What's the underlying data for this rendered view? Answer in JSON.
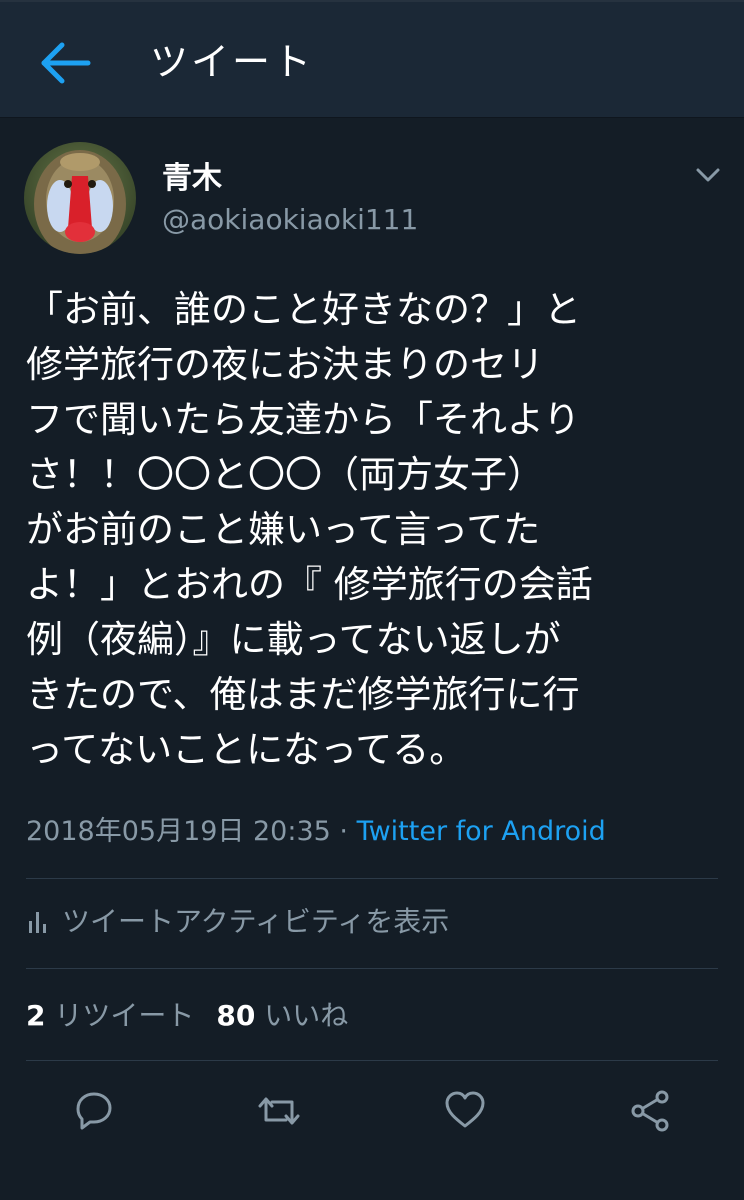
{
  "header": {
    "title": "ツイート",
    "back_icon": "arrow-left-icon"
  },
  "colors": {
    "background": "#141d26",
    "header_background": "#1b2836",
    "accent": "#1da1f2",
    "secondary_text": "#8899a6"
  },
  "tweet": {
    "author": {
      "display_name": "青木",
      "handle": "@aokiaokiaoki111",
      "avatar_icon": "mandrill-avatar"
    },
    "text": "「お前、誰のこと好きなの？」と\n修学旅行の夜にお決まりのセリ\nフで聞いたら友達から「それより\nさ！！〇〇と〇〇（両方女子）\nがお前のこと嫌いって言ってた\nよ！」とおれの『 修学旅行の会話\n例（夜編）』に載ってない返しが\nきたので、俺はまだ修学旅行に行\nってないことになってる。",
    "timestamp": "2018年05月19日 20:35",
    "separator": " · ",
    "source": "Twitter for Android",
    "activity_label": "ツイートアクティビティを表示",
    "retweet_count": "2",
    "retweet_label": "リツイート",
    "like_count": "80",
    "like_label": "いいね"
  },
  "actions": [
    {
      "name": "reply",
      "icon": "reply-icon"
    },
    {
      "name": "retweet",
      "icon": "retweet-icon"
    },
    {
      "name": "like",
      "icon": "heart-icon"
    },
    {
      "name": "share",
      "icon": "share-icon"
    }
  ]
}
